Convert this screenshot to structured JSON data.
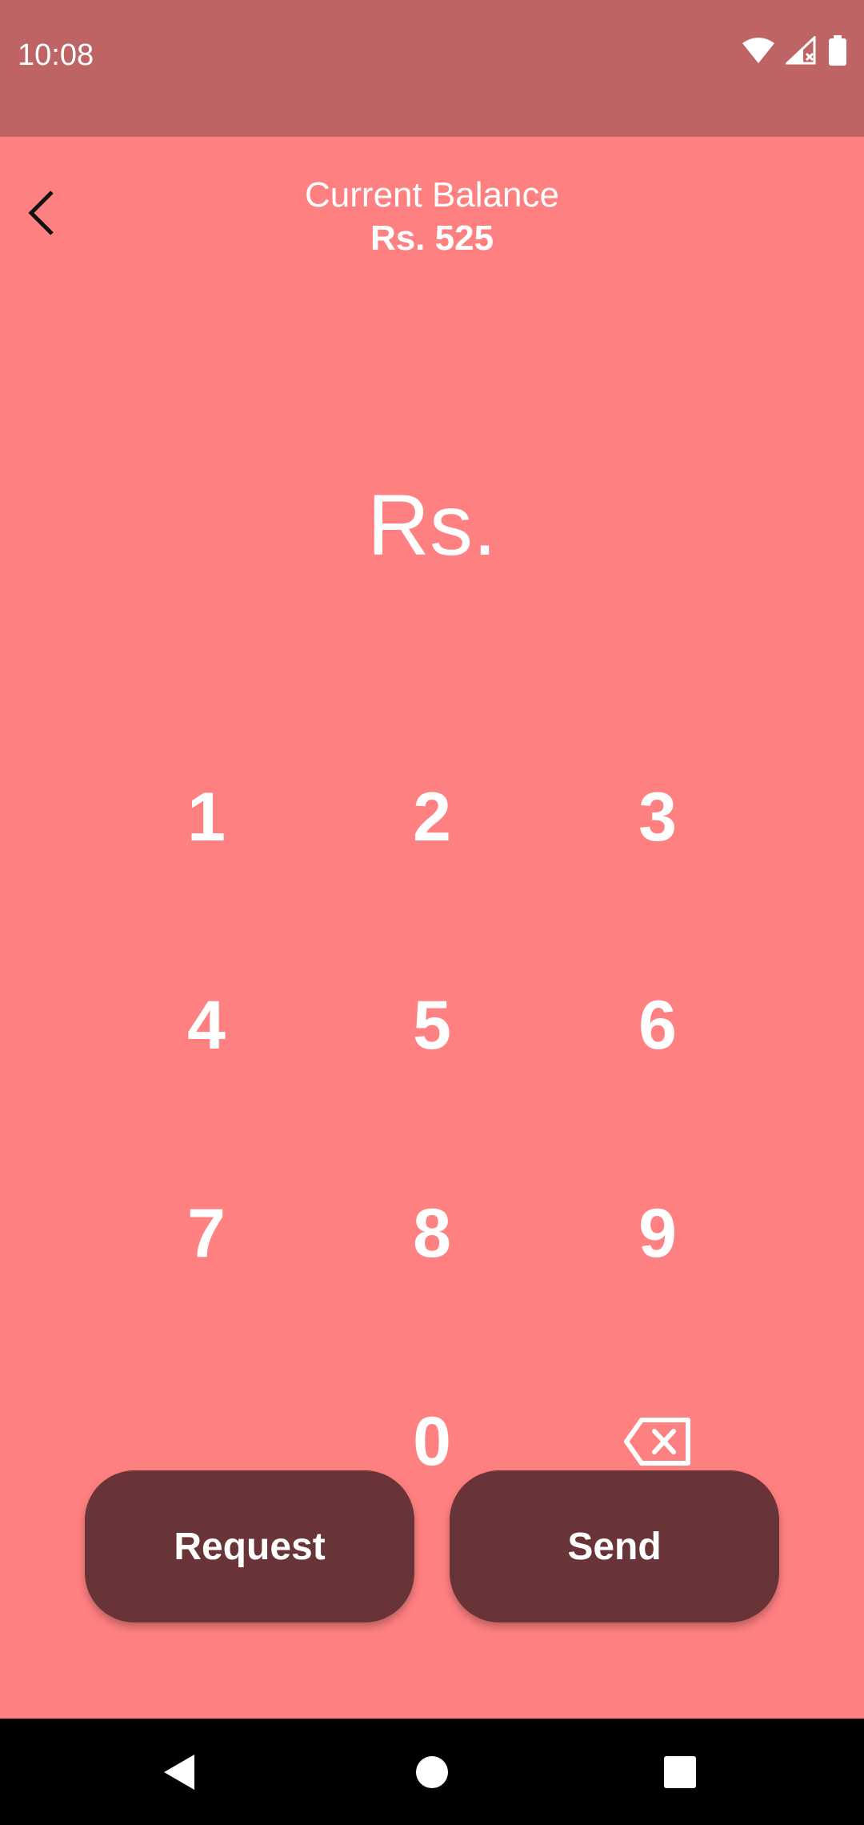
{
  "status_bar": {
    "time": "10:08",
    "icons": [
      "wifi-icon",
      "signal-icon",
      "battery-icon"
    ]
  },
  "header": {
    "back_icon": "chevron-left-icon",
    "balance_label": "Current Balance",
    "balance_value": "Rs. 525"
  },
  "amount_display": "Rs.",
  "keypad": {
    "keys": [
      "1",
      "2",
      "3",
      "4",
      "5",
      "6",
      "7",
      "8",
      "9",
      "",
      "0"
    ],
    "backspace_icon": "backspace-icon"
  },
  "actions": {
    "request_label": "Request",
    "send_label": "Send"
  },
  "nav_bar": {
    "icons": [
      "back-triangle-icon",
      "home-circle-icon",
      "recents-square-icon"
    ]
  },
  "colors": {
    "status_bar": "#bf6464",
    "background": "#ff8080",
    "button": "#683437",
    "nav_bar": "#000000"
  }
}
